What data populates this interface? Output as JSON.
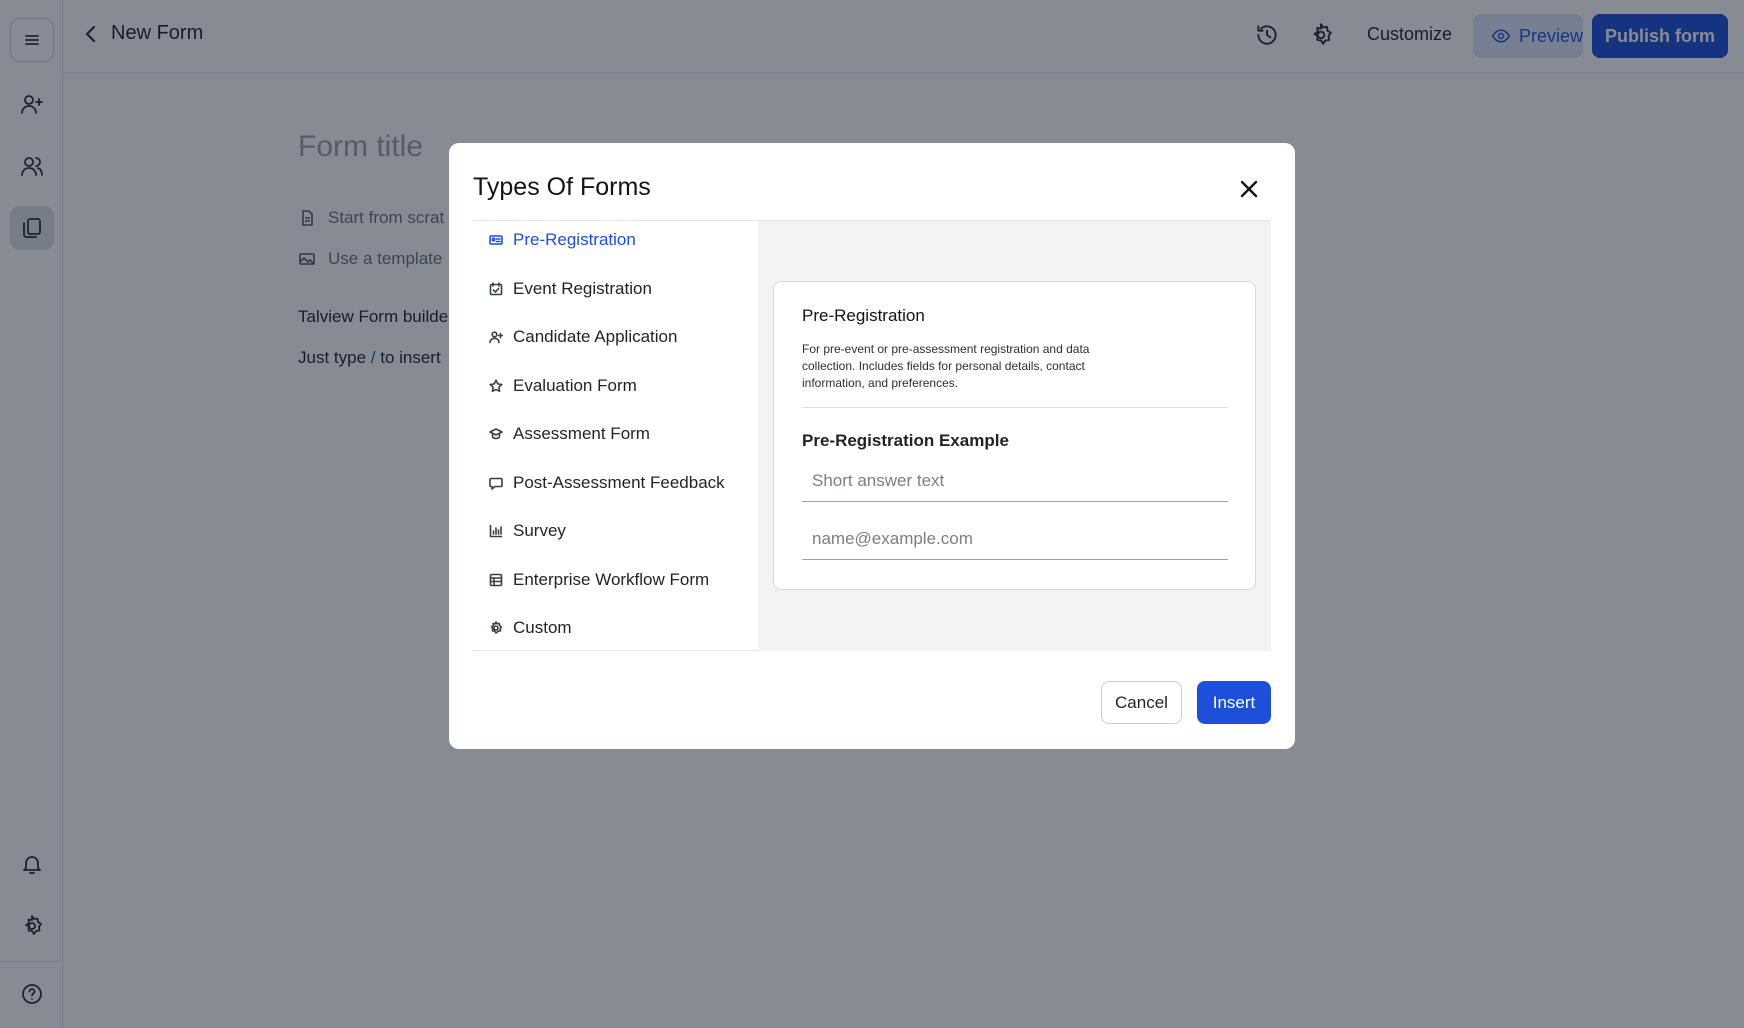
{
  "topbar": {
    "page_name": "New Form",
    "customize_label": "Customize",
    "preview_label": "Preview",
    "publish_label": "Publish form"
  },
  "sidebar": {
    "items": [
      {
        "icon": "menu-icon"
      },
      {
        "icon": "add-user-icon"
      },
      {
        "icon": "users-icon"
      },
      {
        "icon": "documents-icon",
        "active": true
      },
      {
        "icon": "bell-icon"
      },
      {
        "icon": "gear-icon"
      },
      {
        "icon": "help-icon"
      }
    ]
  },
  "canvas": {
    "title_placeholder": "Form title",
    "option_scratch": "Start from scrat",
    "option_template": "Use a template",
    "line1": "Talview Form builde",
    "line2_prefix": "Just type ",
    "line2_slash": "/",
    "line2_suffix": " to insert"
  },
  "modal": {
    "title": "Types Of Forms",
    "types": [
      {
        "label": "Pre-Registration",
        "icon": "id-card-icon",
        "selected": true
      },
      {
        "label": "Event Registration",
        "icon": "calendar-check-icon"
      },
      {
        "label": "Candidate Application",
        "icon": "user-plus-icon"
      },
      {
        "label": "Evaluation Form",
        "icon": "star-icon"
      },
      {
        "label": "Assessment Form",
        "icon": "graduation-cap-icon"
      },
      {
        "label": "Post-Assessment Feedback",
        "icon": "chat-bubble-icon"
      },
      {
        "label": "Survey",
        "icon": "bar-chart-icon"
      },
      {
        "label": "Enterprise Workflow Form",
        "icon": "table-icon"
      },
      {
        "label": "Custom",
        "icon": "gear-icon"
      }
    ],
    "preview": {
      "title": "Pre-Registration",
      "description": "For pre-event or pre-assessment registration and data collection. Includes fields for personal details, contact information, and preferences.",
      "example_title": "Pre-Registration Example",
      "field1_placeholder": "Short answer text",
      "field2_placeholder": "name@example.com"
    },
    "cancel_label": "Cancel",
    "insert_label": "Insert"
  },
  "colors": {
    "accent": "#1d4fd8",
    "overlay": "rgba(15,23,42,0.50)"
  }
}
